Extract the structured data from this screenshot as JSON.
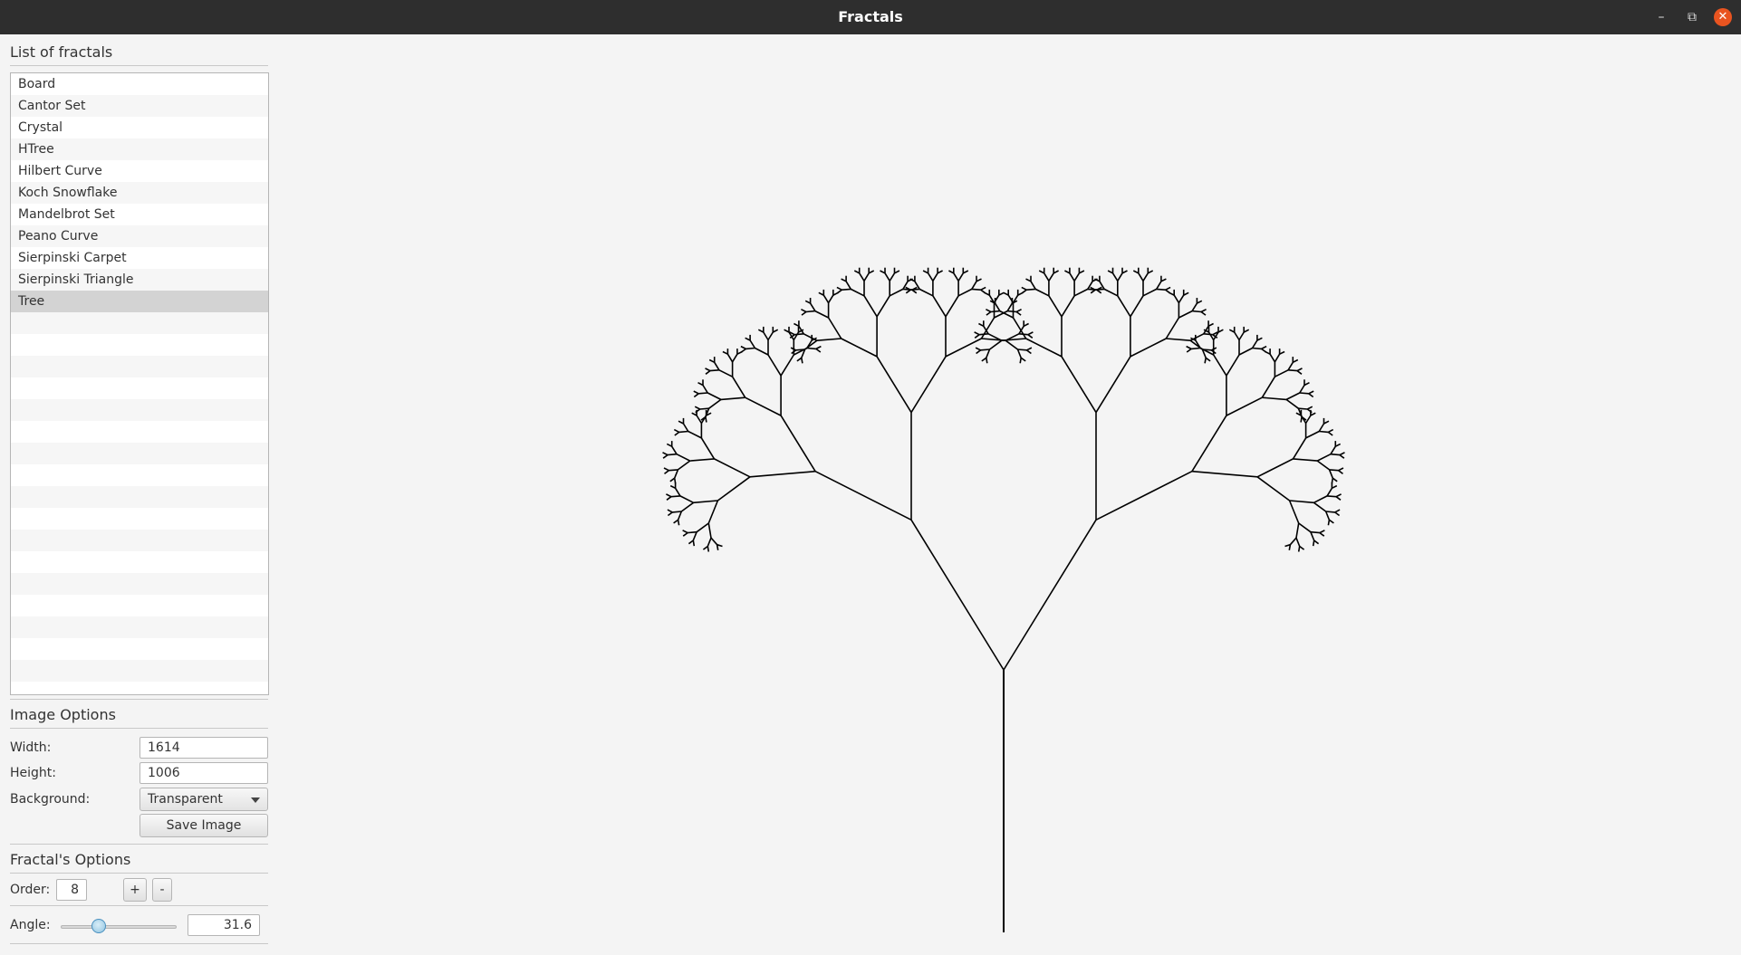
{
  "window": {
    "title": "Fractals"
  },
  "sidebar": {
    "list_title": "List of fractals",
    "items": [
      {
        "label": "Board"
      },
      {
        "label": "Cantor Set"
      },
      {
        "label": "Crystal"
      },
      {
        "label": "HTree"
      },
      {
        "label": "Hilbert Curve"
      },
      {
        "label": "Koch Snowflake"
      },
      {
        "label": "Mandelbrot Set"
      },
      {
        "label": "Peano Curve"
      },
      {
        "label": "Sierpinski Carpet"
      },
      {
        "label": "Sierpinski Triangle"
      },
      {
        "label": "Tree"
      }
    ],
    "selected": "Tree"
  },
  "image_options": {
    "title": "Image Options",
    "width_label": "Width:",
    "width_value": "1614",
    "height_label": "Height:",
    "height_value": "1006",
    "background_label": "Background:",
    "background_value": "Transparent",
    "save_label": "Save Image"
  },
  "fractal_options": {
    "title": "Fractal's Options",
    "order_label": "Order:",
    "order_value": "8",
    "plus_label": "+",
    "minus_label": "-",
    "angle_label": "Angle:",
    "angle_value": "31.6",
    "angle_slider_fraction": 0.33
  },
  "fractal": {
    "order": 8,
    "angle_deg": 31.6,
    "stroke_color": "#000000"
  },
  "colors": {
    "titlebar": "#2e2e2e",
    "close_button": "#e95420",
    "selection": "#d3d3d3"
  }
}
